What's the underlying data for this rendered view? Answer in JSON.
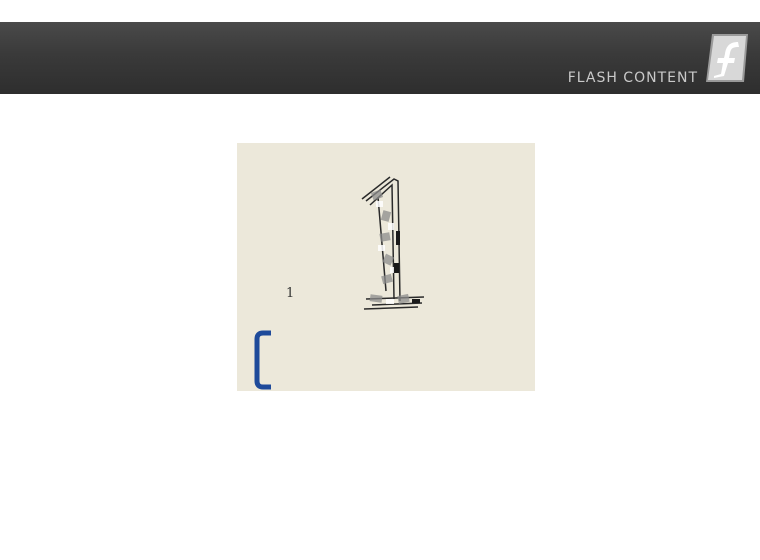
{
  "header": {
    "label": "FLASH CONTENT",
    "logo_icon": "flash-logo-icon"
  },
  "stage": {
    "small_label": "1",
    "big_numeral_icon": "sketched-number-one",
    "bracket_icon": "blue-bracket-icon"
  },
  "colors": {
    "header_bg": "#3a3a3a",
    "header_text": "#c9c9c9",
    "stage_bg": "#ece8da",
    "bracket": "#1e4a9a"
  }
}
